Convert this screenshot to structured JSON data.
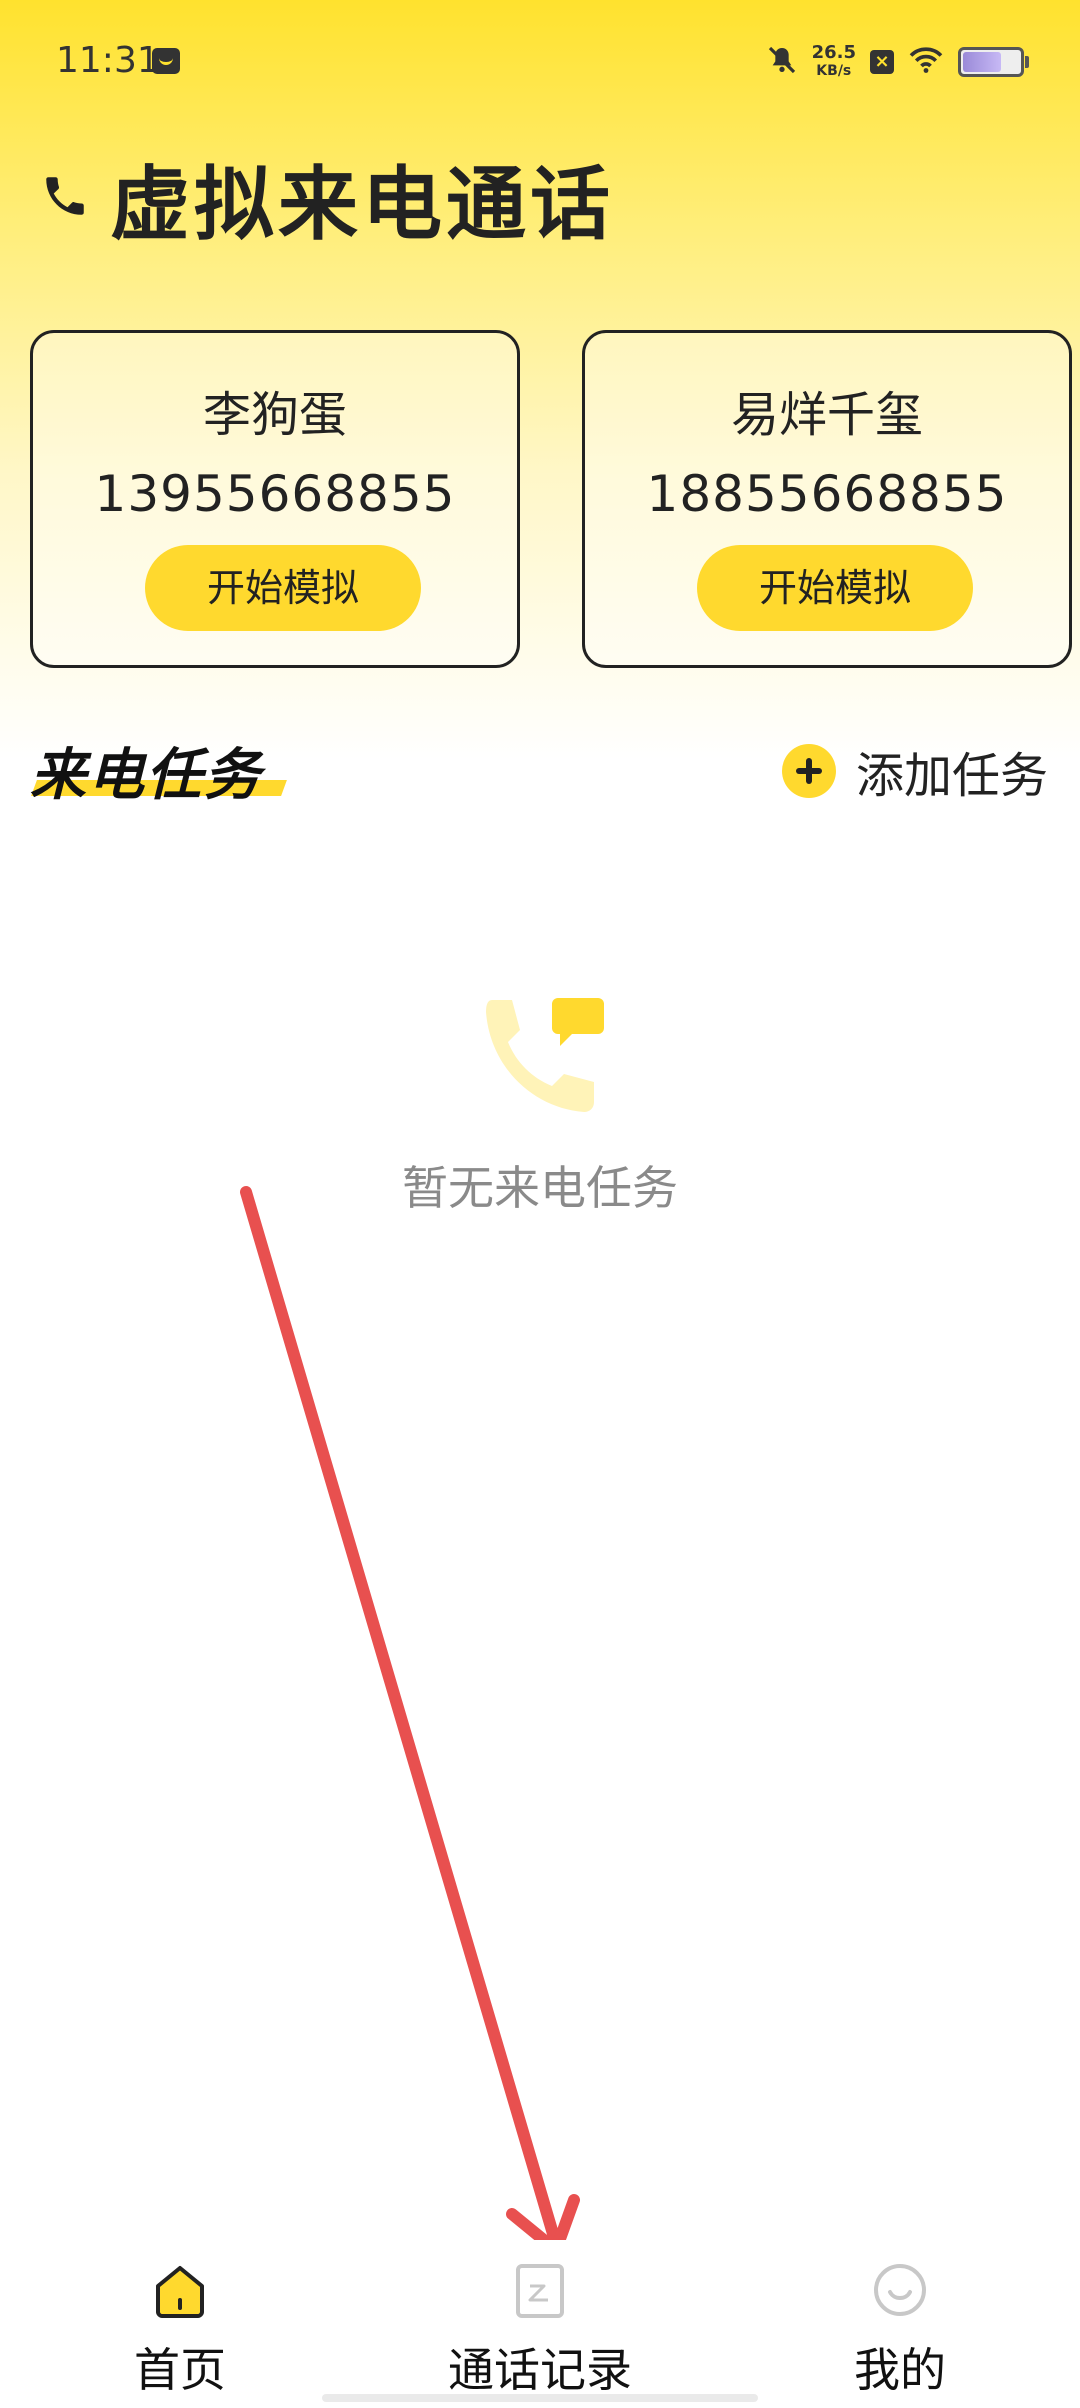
{
  "status_bar": {
    "time": "11:31",
    "net_speed_value": "26.5",
    "net_speed_unit": "KB/s"
  },
  "header": {
    "title": "虚拟来电通话"
  },
  "contacts": [
    {
      "name": "李狗蛋",
      "number": "13955668855",
      "button_label": "开始模拟"
    },
    {
      "name": "易烊千玺",
      "number": "18855668855",
      "button_label": "开始模拟"
    }
  ],
  "tasks_section": {
    "title": "来电任务",
    "add_label": "添加任务",
    "empty_text": "暂无来电任务"
  },
  "bottom_nav": {
    "items": [
      {
        "label": "首页",
        "icon": "home-icon",
        "active": true
      },
      {
        "label": "通话记录",
        "icon": "call-log-icon",
        "active": false
      },
      {
        "label": "我的",
        "icon": "profile-icon",
        "active": false
      }
    ]
  },
  "colors": {
    "accent": "#FFD92E",
    "annotation_arrow": "#E8504F"
  }
}
